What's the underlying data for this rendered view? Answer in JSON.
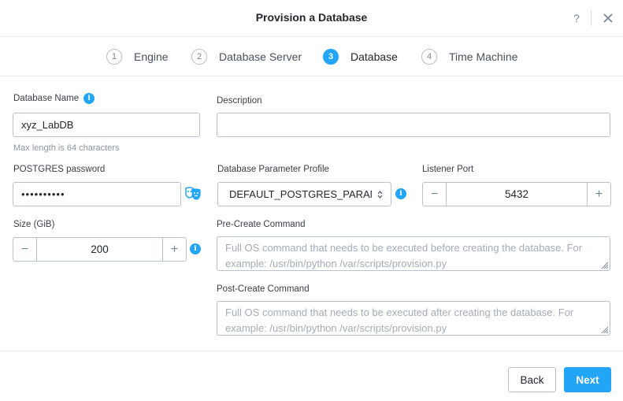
{
  "header": {
    "title": "Provision a Database",
    "help_label": "?",
    "close_icon": "close-icon"
  },
  "steps": [
    {
      "number": "1",
      "label": "Engine",
      "active": false
    },
    {
      "number": "2",
      "label": "Database Server",
      "active": false
    },
    {
      "number": "3",
      "label": "Database",
      "active": true
    },
    {
      "number": "4",
      "label": "Time Machine",
      "active": false
    }
  ],
  "form": {
    "db_name": {
      "label": "Database Name",
      "value": "xyz_LabDB",
      "hint": "Max length is 64 characters"
    },
    "description": {
      "label": "Description",
      "value": ""
    },
    "password": {
      "label": "POSTGRES password",
      "value": "••••••••••",
      "toggle_icon": "mask-icon"
    },
    "param_profile": {
      "label": "Database Parameter Profile",
      "value": "DEFAULT_POSTGRES_PARAMS"
    },
    "listener_port": {
      "label": "Listener Port",
      "value": "5432"
    },
    "size": {
      "label": "Size (GiB)",
      "value": "200"
    },
    "pre_create": {
      "label": "Pre-Create Command",
      "placeholder": "Full OS command that needs to be executed before creating the database. For example: /usr/bin/python /var/scripts/provision.py"
    },
    "post_create": {
      "label": "Post-Create Command",
      "placeholder": "Full OS command that needs to be executed after creating the database. For example: /usr/bin/python /var/scripts/provision.py"
    },
    "minus": "−",
    "plus": "+",
    "info_glyph": "i"
  },
  "footer": {
    "back_label": "Back",
    "next_label": "Next"
  },
  "colors": {
    "accent": "#22a5f7",
    "border": "#b9c2cc",
    "text": "#22272e"
  }
}
